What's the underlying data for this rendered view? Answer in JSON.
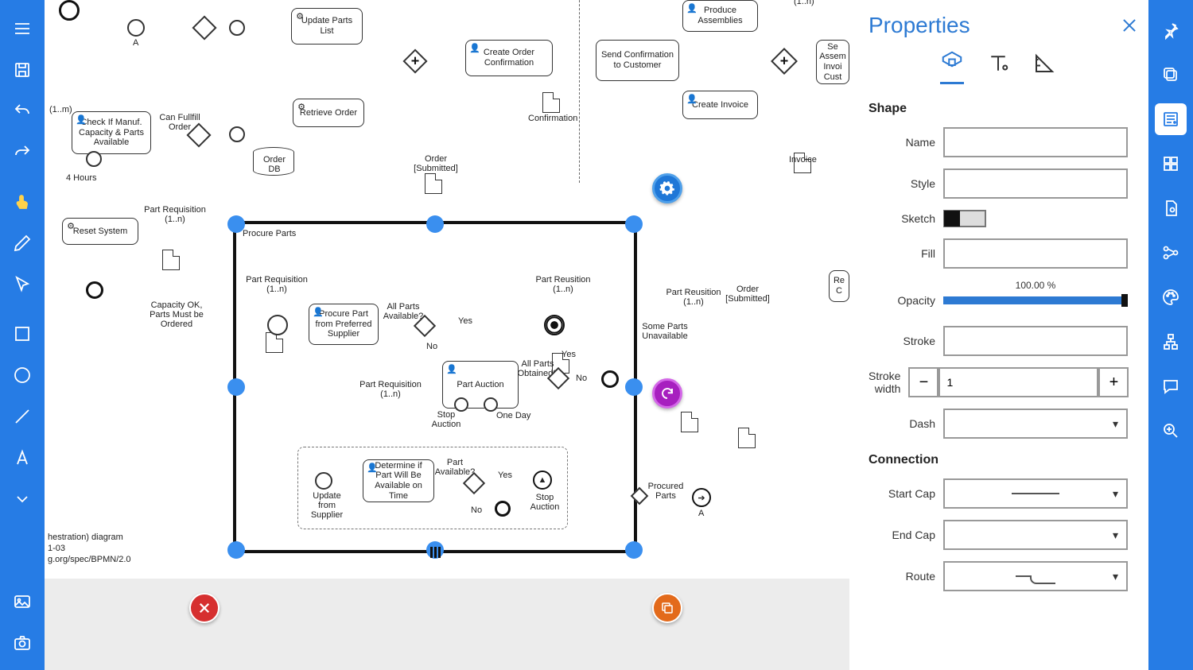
{
  "panel_title": "Properties",
  "shape_section": "Shape",
  "connection_section": "Connection",
  "labels": {
    "name": "Name",
    "style": "Style",
    "sketch": "Sketch",
    "fill": "Fill",
    "opacity": "Opacity",
    "stroke": "Stroke",
    "stroke_width": "Stroke width",
    "dash": "Dash",
    "start_cap": "Start Cap",
    "end_cap": "End Cap",
    "route": "Route"
  },
  "values": {
    "name": "",
    "style": "",
    "opacity_pct": "100.00 %",
    "stroke_width": "1",
    "dash": ""
  },
  "diagram": {
    "selected_subprocess": "Procure Parts",
    "footer_lines": {
      "l1": "hestration) diagram",
      "l2": "1-03",
      "l3": "g.org/spec/BPMN/2.0"
    },
    "texts": {
      "multiplicity": "(1..n)",
      "multiplicity_m": "(1..m)",
      "a": "A",
      "update_parts": "Update Parts List",
      "check_capacity": "Check If Manuf. Capacity & Parts Available",
      "four_hours": "4 Hours",
      "reset_system": "Reset System",
      "can_fulfill": "Can Fullfill Order",
      "part_requisition": "Part Requisition (1..n)",
      "part_reusition": "Part Reusition (1..n)",
      "order_db": "Order DB",
      "retrieve_order": "Retrieve Order",
      "order_submitted": "Order [Submitted]",
      "confirmation": "Confirmation",
      "create_order_conf": "Create Order Confirmation",
      "send_conf": "Send Confirmation to Customer",
      "produce_assy": "Produce Assemblies",
      "create_invoice": "Create Invoice",
      "se_assem_invoi": "Se Assem Invoi Cust",
      "invoice": "Invoice",
      "capacity_ok": "Capacity OK, Parts Must be Ordered",
      "procure_pref": "Procure Part from Preferred Supplier",
      "all_parts_avail": "All Parts Available?",
      "all_parts_obt": "All Parts Obtained?",
      "yes": "Yes",
      "no": "No",
      "part_auction": "Part Auction",
      "stop_auction": "Stop Auction",
      "one_day": "One Day",
      "some_unavail": "Some Parts Unavailable",
      "determine_time": "Determine if Part Will Be Available on Time",
      "part_available": "Part Available?",
      "update_supplier": "Update from Supplier",
      "procured_parts": "Procured Parts",
      "re_c": "Re C"
    }
  }
}
